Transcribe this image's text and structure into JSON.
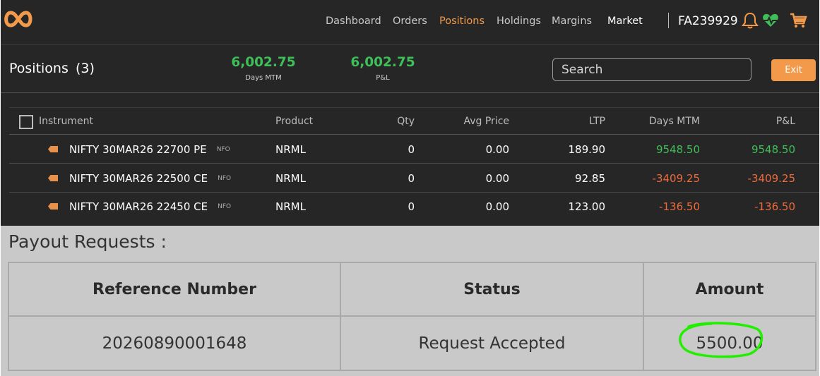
{
  "nav": {
    "links": [
      {
        "label": "Dashboard"
      },
      {
        "label": "Orders"
      },
      {
        "label": "Positions"
      },
      {
        "label": "Holdings"
      },
      {
        "label": "Margins"
      },
      {
        "label": "Market"
      }
    ],
    "active": "Positions",
    "user_id": "FA239929"
  },
  "icons": {
    "logo": "infinity-logo-icon",
    "bell": "bell-icon",
    "heart": "heart-pulse-icon",
    "cart": "cart-icon"
  },
  "summary": {
    "title": "Positions",
    "count": "(3)",
    "days_mtm_value": "6,002.75",
    "days_mtm_label": "Days MTM",
    "pnl_value": "6,002.75",
    "pnl_label": "P&L",
    "search_placeholder": "Search",
    "exit_label": "Exit"
  },
  "table": {
    "headers": [
      "Instrument",
      "Product",
      "Qty",
      "Avg Price",
      "LTP",
      "Days MTM",
      "P&L"
    ],
    "rows": [
      {
        "instrument": "NIFTY 30MAR26 22700 PE",
        "exchange": "NFO",
        "product": "NRML",
        "qty": "0",
        "avg_price": "0.00",
        "ltp": "189.90",
        "days_mtm": "9548.50",
        "pnl": "9548.50"
      },
      {
        "instrument": "NIFTY 30MAR26 22500 CE",
        "exchange": "NFO",
        "product": "NRML",
        "qty": "0",
        "avg_price": "0.00",
        "ltp": "92.85",
        "days_mtm": "-3409.25",
        "pnl": "-3409.25"
      },
      {
        "instrument": "NIFTY 30MAR26 22450 CE",
        "exchange": "NFO",
        "product": "NRML",
        "qty": "0",
        "avg_price": "0.00",
        "ltp": "123.00",
        "days_mtm": "-136.50",
        "pnl": "-136.50"
      }
    ]
  },
  "colors": {
    "accent": "#f2994a",
    "positive": "#3fbf58",
    "negative": "#f06a3a",
    "highlight": "#22ee00"
  },
  "payout": {
    "title": "Payout Requests :",
    "headers": [
      "Reference Number",
      "Status",
      "Amount"
    ],
    "row": {
      "reference": "20260890001648",
      "status": "Request Accepted",
      "amount": "5500.00"
    }
  }
}
